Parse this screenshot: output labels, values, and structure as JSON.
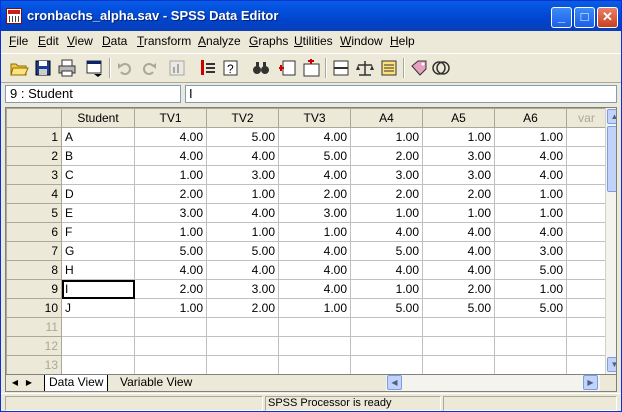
{
  "window": {
    "title": "cronbachs_alpha.sav - SPSS Data Editor",
    "minimize": "_",
    "maximize": "□",
    "close": "✕"
  },
  "menu": [
    {
      "label": "File",
      "u": "F",
      "rest": "ile"
    },
    {
      "label": "Edit",
      "u": "E",
      "rest": "dit"
    },
    {
      "label": "View",
      "u": "V",
      "rest": "iew"
    },
    {
      "label": "Data",
      "u": "D",
      "rest": "ata"
    },
    {
      "label": "Transform",
      "u": "T",
      "rest": "ransform"
    },
    {
      "label": "Analyze",
      "u": "A",
      "rest": "nalyze"
    },
    {
      "label": "Graphs",
      "u": "G",
      "rest": "raphs"
    },
    {
      "label": "Utilities",
      "u": "U",
      "rest": "tilities"
    },
    {
      "label": "Window",
      "u": "W",
      "rest": "indow"
    },
    {
      "label": "Help",
      "u": "H",
      "rest": "elp"
    }
  ],
  "toolbar": {
    "icons": [
      "open-file-icon",
      "save-icon",
      "print-icon",
      "dialog-recall-icon",
      "undo-icon",
      "redo-icon",
      "goto-chart-icon",
      "goto-case-icon",
      "variables-icon",
      "find-icon",
      "insert-cases-icon",
      "insert-variable-icon",
      "split-file-icon",
      "weight-cases-icon",
      "select-cases-icon",
      "value-labels-icon",
      "use-sets-icon"
    ]
  },
  "cell_editor": {
    "reference": "9 : Student",
    "value": "I"
  },
  "grid": {
    "columns": [
      "Student",
      "TV1",
      "TV2",
      "TV3",
      "A4",
      "A5",
      "A6",
      "var"
    ],
    "rows": [
      {
        "n": "1",
        "cells": [
          "A",
          "4.00",
          "5.00",
          "4.00",
          "1.00",
          "1.00",
          "1.00"
        ]
      },
      {
        "n": "2",
        "cells": [
          "B",
          "4.00",
          "4.00",
          "5.00",
          "2.00",
          "3.00",
          "4.00"
        ]
      },
      {
        "n": "3",
        "cells": [
          "C",
          "1.00",
          "3.00",
          "4.00",
          "3.00",
          "3.00",
          "4.00"
        ]
      },
      {
        "n": "4",
        "cells": [
          "D",
          "2.00",
          "1.00",
          "2.00",
          "2.00",
          "2.00",
          "1.00"
        ]
      },
      {
        "n": "5",
        "cells": [
          "E",
          "3.00",
          "4.00",
          "3.00",
          "1.00",
          "1.00",
          "1.00"
        ]
      },
      {
        "n": "6",
        "cells": [
          "F",
          "1.00",
          "1.00",
          "1.00",
          "4.00",
          "4.00",
          "4.00"
        ]
      },
      {
        "n": "7",
        "cells": [
          "G",
          "5.00",
          "5.00",
          "4.00",
          "5.00",
          "4.00",
          "3.00"
        ]
      },
      {
        "n": "8",
        "cells": [
          "H",
          "4.00",
          "4.00",
          "4.00",
          "4.00",
          "4.00",
          "5.00"
        ]
      },
      {
        "n": "9",
        "cells": [
          "I",
          "2.00",
          "3.00",
          "4.00",
          "1.00",
          "2.00",
          "1.00"
        ]
      },
      {
        "n": "10",
        "cells": [
          "J",
          "1.00",
          "2.00",
          "1.00",
          "5.00",
          "5.00",
          "5.00"
        ]
      },
      {
        "n": "11",
        "cells": [
          "",
          "",
          "",
          "",
          "",
          "",
          ""
        ]
      },
      {
        "n": "12",
        "cells": [
          "",
          "",
          "",
          "",
          "",
          "",
          ""
        ]
      },
      {
        "n": "13",
        "cells": [
          "",
          "",
          "",
          "",
          "",
          "",
          ""
        ]
      }
    ],
    "selected_row": 9,
    "selected_col": 0
  },
  "tabs": {
    "data_view": "Data View",
    "variable_view": "Variable View"
  },
  "status": {
    "processor": "SPSS Processor  is ready"
  }
}
